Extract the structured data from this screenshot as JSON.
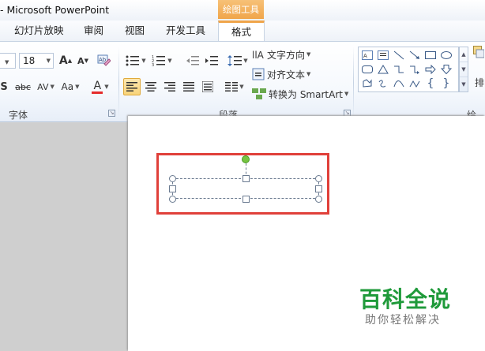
{
  "titlebar": {
    "app_title": "- Microsoft PowerPoint",
    "context_tab_group": "绘图工具"
  },
  "tabs": [
    {
      "label": "幻灯片放映",
      "active": false
    },
    {
      "label": "审阅",
      "active": false
    },
    {
      "label": "视图",
      "active": false
    },
    {
      "label": "开发工具",
      "active": false
    },
    {
      "label": "格式",
      "active": true
    }
  ],
  "ribbon": {
    "font_group": {
      "label": "字体",
      "font_name_stub": "",
      "font_size": "18",
      "buttons": {
        "grow_font": "A",
        "shrink_font": "A",
        "shadow": "S",
        "strikethrough": "abc",
        "char_spacing": "AV",
        "change_case": "Aa",
        "font_color": "A"
      }
    },
    "paragraph_group": {
      "label": "段落",
      "text_direction": "文字方向",
      "align_text": "对齐文本",
      "convert_smartart": "转换为 SmartArt"
    },
    "drawing_group": {
      "label": "绘图",
      "arrange_stub": "排"
    },
    "colors": {
      "font_color_bar": "#e52b2b",
      "active_tab_accent": "#f0a54a"
    }
  },
  "slide": {
    "selection_color": "#e0403a",
    "rotate_handle_color": "#76c441"
  },
  "watermark": {
    "title": "百科全说",
    "subtitle": "助你轻松解决"
  }
}
